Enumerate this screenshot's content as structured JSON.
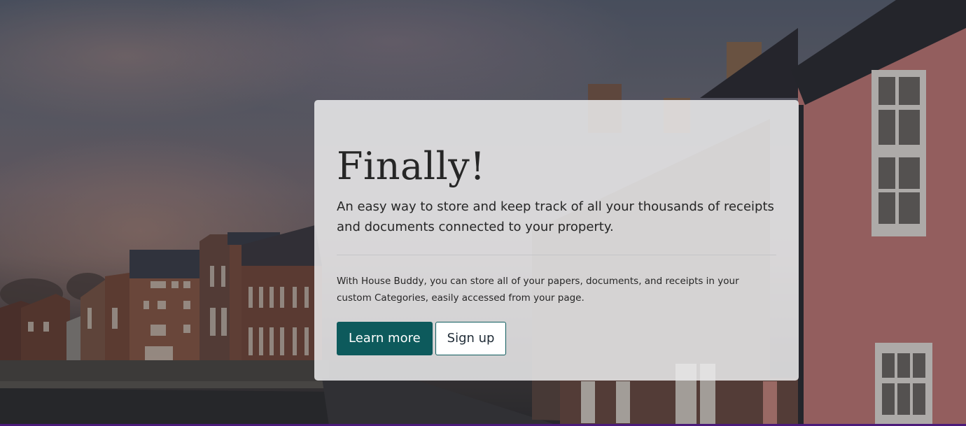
{
  "hero": {
    "background_image": "street-of-brick-houses-by-river",
    "title": "Finally!",
    "lead": "An easy way to store and keep track of all your thousands of receipts and documents connected to your property.",
    "body": "With House Buddy, you can store all of your papers, documents, and receipts in your custom Categories, easily accessed from your page.",
    "buttons": {
      "learn_more": "Learn more",
      "sign_up": "Sign up"
    }
  },
  "colors": {
    "primary": "#0d5a5c",
    "card_background": "#ececee",
    "text": "#262626",
    "bottom_accent": "#4b1a7a"
  }
}
